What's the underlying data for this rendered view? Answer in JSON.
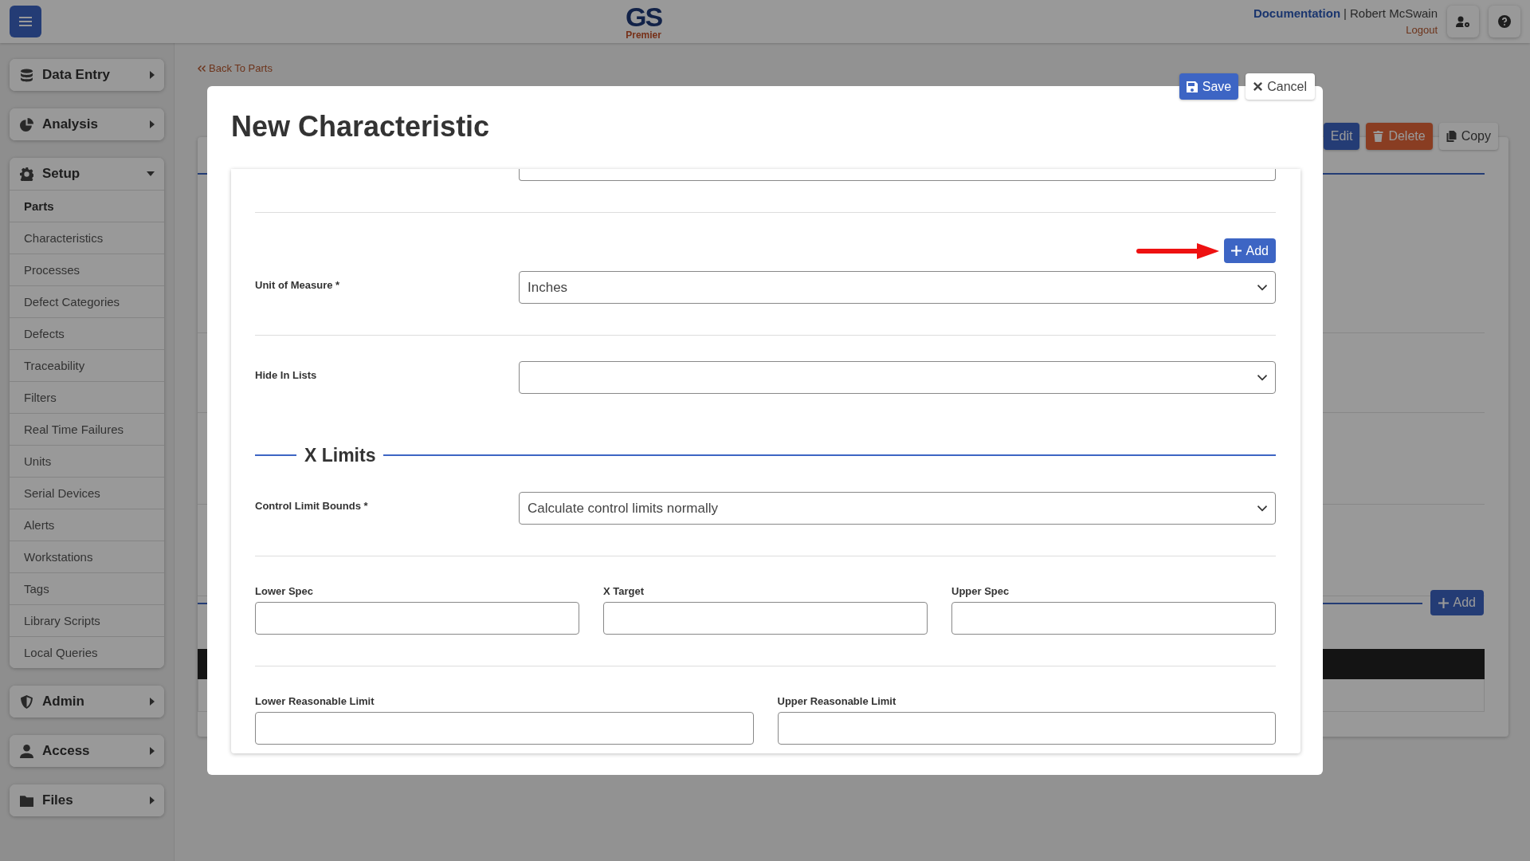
{
  "topbar": {
    "logo": {
      "mark": "GS",
      "sub": "Premier"
    },
    "doc_link": "Documentation",
    "separator": "|",
    "user": "Robert McSwain",
    "logout": "Logout"
  },
  "sidebar": [
    {
      "label": "Data Entry",
      "expanded": false
    },
    {
      "label": "Analysis",
      "expanded": false
    },
    {
      "label": "Setup",
      "expanded": true,
      "items": [
        {
          "label": "Parts",
          "selected": true
        },
        {
          "label": "Characteristics",
          "selected": false
        },
        {
          "label": "Processes",
          "selected": false
        },
        {
          "label": "Defect Categories",
          "selected": false
        },
        {
          "label": "Defects",
          "selected": false
        },
        {
          "label": "Traceability",
          "selected": false
        },
        {
          "label": "Filters",
          "selected": false
        },
        {
          "label": "Real Time Failures",
          "selected": false
        },
        {
          "label": "Units",
          "selected": false
        },
        {
          "label": "Serial Devices",
          "selected": false
        },
        {
          "label": "Alerts",
          "selected": false
        },
        {
          "label": "Workstations",
          "selected": false
        },
        {
          "label": "Tags",
          "selected": false
        },
        {
          "label": "Library Scripts",
          "selected": false
        },
        {
          "label": "Local Queries",
          "selected": false
        }
      ]
    },
    {
      "label": "Admin",
      "expanded": false
    },
    {
      "label": "Access",
      "expanded": false
    },
    {
      "label": "Files",
      "expanded": false
    }
  ],
  "background_page": {
    "back_link": "Back To Parts",
    "buttons": [
      {
        "kind": "edit",
        "label": "Edit"
      },
      {
        "kind": "delete",
        "label": "Delete"
      },
      {
        "kind": "copy",
        "label": "Copy"
      }
    ],
    "add_button": "Add"
  },
  "modal": {
    "title": "New Characteristic",
    "save": "Save",
    "cancel": "Cancel",
    "rows": [
      {
        "kind": "partial"
      },
      {
        "kind": "select",
        "label": "Unit of Measure *",
        "value": "Inches",
        "add_button": "Add"
      },
      {
        "kind": "select",
        "label": "Hide In Lists",
        "value": ""
      },
      {
        "kind": "section",
        "label": "X Limits"
      },
      {
        "kind": "select",
        "label": "Control Limit Bounds *",
        "value": "Calculate control limits normally"
      },
      {
        "kind": "inputs",
        "fields": [
          {
            "label": "Lower Spec"
          },
          {
            "label": "X Target"
          },
          {
            "label": "Upper Spec"
          }
        ]
      },
      {
        "kind": "inputs",
        "fields": [
          {
            "label": "Lower Reasonable Limit"
          },
          {
            "label": "Upper Reasonable Limit"
          }
        ]
      }
    ]
  }
}
